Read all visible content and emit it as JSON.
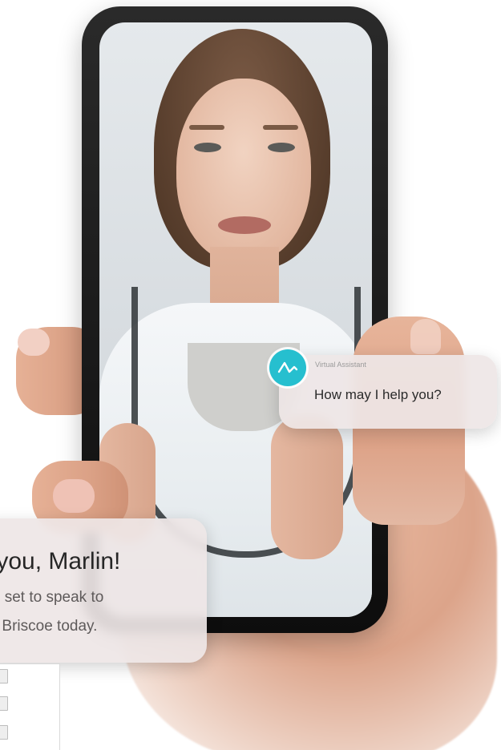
{
  "virtual_assistant": {
    "name": "Virtual Assistant",
    "message": "How may I help you?",
    "avatar_icon": "assistant-logo-icon",
    "avatar_color": "#26bfcf"
  },
  "confirmation": {
    "title": "k you, Marlin!",
    "line1": "ll set to speak to",
    "line2": "ua Briscoe today."
  },
  "checklist": {
    "items": [
      {
        "checked": false
      },
      {
        "checked": false
      },
      {
        "checked": false
      }
    ]
  }
}
